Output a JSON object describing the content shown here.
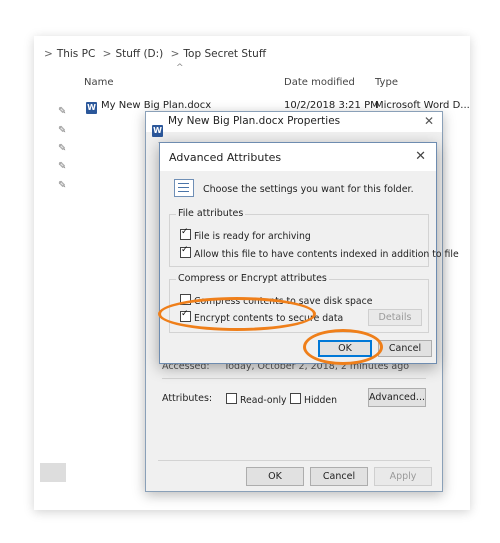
{
  "explorer": {
    "breadcrumb": [
      "This PC",
      "Stuff (D:)",
      "Top Secret Stuff"
    ],
    "separator": ">",
    "columns": {
      "name": "Name",
      "date": "Date modified",
      "type": "Type"
    },
    "file": {
      "name": "My New Big Plan.docx",
      "date": "10/2/2018 3:21 PM",
      "type": "Microsoft Word D..."
    }
  },
  "properties": {
    "title": "My New Big Plan.docx Properties",
    "accessed_label": "Accessed:",
    "accessed_value": "Today, October 2, 2018, 2 minutes ago",
    "attributes_label": "Attributes:",
    "readonly_label": "Read-only",
    "hidden_label": "Hidden",
    "advanced_button": "Advanced...",
    "ok": "OK",
    "cancel": "Cancel",
    "apply": "Apply"
  },
  "advanced": {
    "title": "Advanced Attributes",
    "description": "Choose the settings you want for this folder.",
    "file_attributes_title": "File attributes",
    "archive_label": "File is ready for archiving",
    "index_label": "Allow this file to have contents indexed in addition to file",
    "compress_group_title": "Compress or Encrypt attributes",
    "compress_label": "Compress contents to save disk space",
    "encrypt_label": "Encrypt contents to secure data",
    "details_button": "Details",
    "ok": "OK",
    "cancel": "Cancel"
  },
  "colors": {
    "highlight_ring": "#ef7f1a",
    "accent": "#0078d7"
  },
  "icons": [
    "pin-icon",
    "word-doc-icon",
    "close-icon",
    "attributes-list-icon"
  ]
}
